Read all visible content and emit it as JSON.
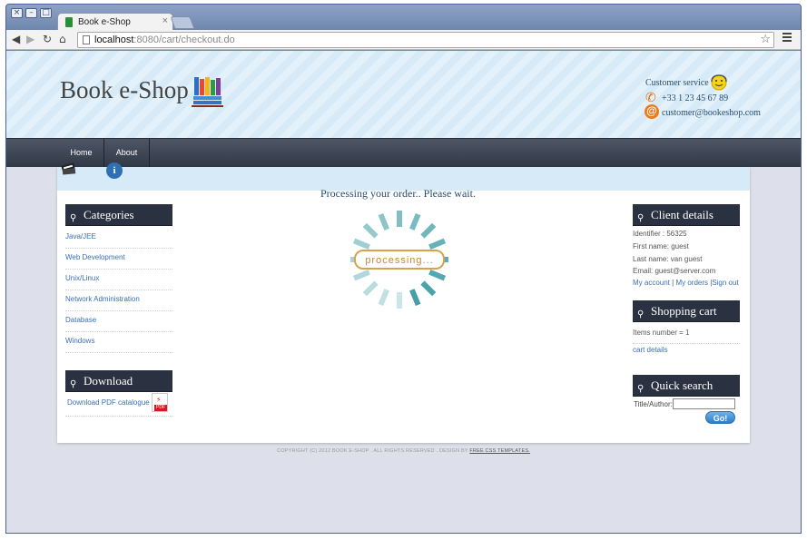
{
  "browser": {
    "tab_title": "Book e-Shop",
    "tab_close": "×",
    "url_host": "localhost",
    "url_rest": ":8080/cart/checkout.do",
    "window_buttons": [
      "×",
      "–",
      "□"
    ]
  },
  "header": {
    "logo": "Book e-Shop",
    "customer_service": {
      "title": "Customer service",
      "phone": "+33 1 23 45 67 89",
      "email": "customer@bookeshop.com"
    }
  },
  "nav": {
    "items": [
      {
        "label": "Home"
      },
      {
        "label": "About"
      }
    ]
  },
  "left": {
    "categories_title": "Categories",
    "categories": [
      "Java/JEE",
      "Web Development",
      "Unix/Linux",
      "Network Administration",
      "Database",
      "Windows"
    ],
    "download_title": "Download",
    "download_link": "Download PDF catalogue",
    "pdf_label": "PDF"
  },
  "main": {
    "processing_title": "Processing your order.. Please wait.",
    "spinner_label": "processing..."
  },
  "right": {
    "client_title": "Client details",
    "identifier": "Identifier : 56325",
    "first_name": "First name: guest",
    "last_name": "Last name: van guest",
    "email": "Email: guest@server.com",
    "link_account": "My account",
    "link_orders": "My orders",
    "link_signout": "Sign out",
    "sep1": " | ",
    "sep2": " |",
    "cart_title": "Shopping cart",
    "items_number": "Items number = 1",
    "cart_details": "cart details",
    "search_title": "Quick search",
    "search_label": "Title/Author:",
    "search_value": "",
    "go_label": "Go!"
  },
  "footer": {
    "text": "COPYRIGHT (C) 2012 BOOK E-SHOP . ALL RIGHTS RESERVED .  DESIGN BY ",
    "link": "FREE CSS TEMPLATES."
  },
  "colors": {
    "header_bg": "#d6ebf7",
    "navbar": "#3a424f",
    "box_header": "#2a3140",
    "link": "#3b6fb3",
    "spinner": "#3a9aa3"
  }
}
